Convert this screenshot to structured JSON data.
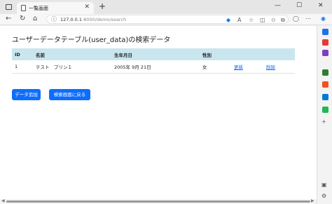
{
  "browser": {
    "tab_title": "一覧画面",
    "tab_close": "✕",
    "new_tab": "+",
    "url_host": "127.0.0.1",
    "url_path": ":8000/demo/search",
    "controls": {
      "minimize": "—",
      "maximize": "☐",
      "close": "✕"
    }
  },
  "page": {
    "heading": "ユーザーデータテーブル(user_data)の検索データ",
    "table": {
      "headers": [
        "ID",
        "名前",
        "生年月日",
        "性別",
        "",
        ""
      ],
      "rows": [
        {
          "id": "1",
          "name": "テスト　プリン１",
          "birthdate": "2005年 9月 21日",
          "gender": "女",
          "edit_label": "更新",
          "delete_label": "削除"
        }
      ]
    },
    "add_button": "データ追加",
    "back_button": "検索画面に戻る"
  },
  "sidebar_icon_colors": [
    "#1a73e8",
    "#e53935",
    "#7b3fbf",
    "#2e7d32",
    "#f25022",
    "#0078d4",
    "#1db954"
  ]
}
